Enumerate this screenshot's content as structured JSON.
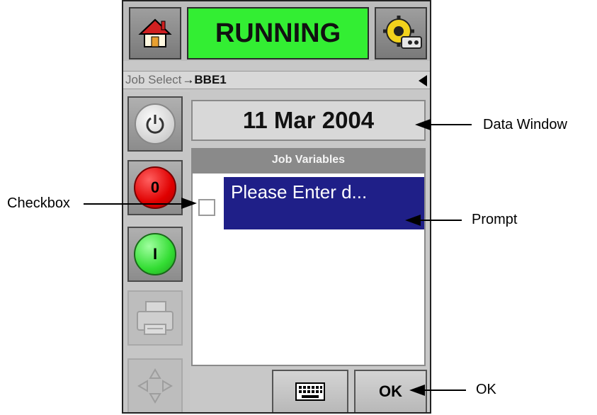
{
  "device": {
    "status": "RUNNING",
    "breadcrumb": {
      "path": "Job Select",
      "separator": "→",
      "current": "BBE1"
    },
    "date_window": "11 Mar 2004",
    "job_variables_title": "Job Variables",
    "prompt_text": "Please Enter d...",
    "stop_label": "0",
    "start_label": "I",
    "ok_label": "OK",
    "icons": [
      "home-icon",
      "settings-icon",
      "back-arrow-icon",
      "power-icon",
      "print-icon",
      "navigate-icon",
      "keyboard-icon"
    ],
    "colors": {
      "status_bg": "#33ee33",
      "prompt_bg": "#1f1f88",
      "stop_red": "#e00000",
      "start_green": "#33dd33"
    }
  },
  "callouts": {
    "data_window": "Data Window",
    "checkbox": "Checkbox",
    "prompt": "Prompt",
    "ok": "OK"
  }
}
